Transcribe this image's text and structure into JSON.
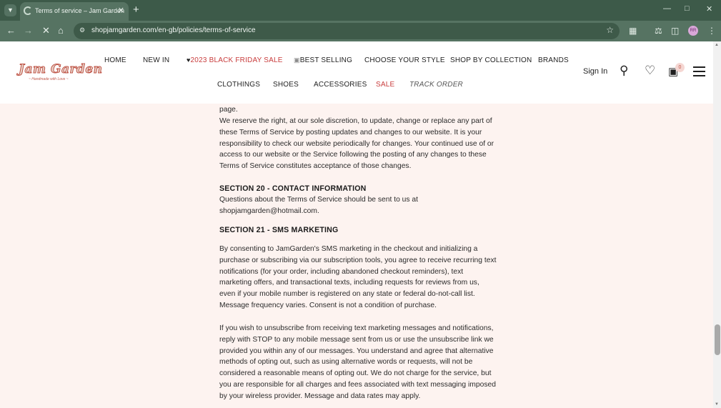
{
  "browser": {
    "tab_title": "Terms of service – Jam Garden",
    "url": "shopjamgarden.com/en-gb/policies/terms-of-service",
    "profile_initials": "RR"
  },
  "icons": {
    "tab_search": "chevron-down-icon",
    "spinner": "loading-spinner-icon",
    "tab_close": "close-icon",
    "new_tab": "plus-icon",
    "back": "arrow-left-icon",
    "forward": "arrow-right-icon",
    "stop": "close-icon",
    "home": "home-icon",
    "site_info": "tune-icon",
    "bookmark": "star-icon",
    "extensions": "puzzle-icon",
    "labs": "flask-icon",
    "sidebar": "sidebar-icon",
    "menu": "more-vertical-icon",
    "search": "search-icon",
    "wishlist": "heart-icon",
    "cart": "cart-icon",
    "hamburger": "hamburger-icon"
  },
  "site": {
    "logo_text": "Jam Garden",
    "logo_tagline": "~ Handmade with Love ~",
    "nav_row1": [
      "HOME",
      "NEW IN",
      "2023 BLACK FRIDAY SALE",
      "BEST SELLING",
      "CHOOSE YOUR STYLE",
      "SHOP BY COLLECTION",
      "BRANDS"
    ],
    "nav_row2": [
      "CLOTHINGS",
      "SHOES",
      "ACCESSORIES",
      "SALE",
      "TRACK ORDER"
    ],
    "sign_in": "Sign In",
    "cart_count": "0"
  },
  "colors": {
    "accent_red": "#c83c3c",
    "page_bg": "#fdf3f0",
    "browser_frame": "#3d5a49"
  },
  "article": {
    "p_page": "page.",
    "p_reserve": "We reserve the right, at our sole discretion, to update, change or replace any part of these Terms of Service by posting updates and changes to our website. It is your responsibility to check our website periodically for changes. Your continued use of or access to our website or the Service following the posting of any changes to these Terms of Service constitutes acceptance of those changes.",
    "s20_title": "SECTION 20 - CONTACT INFORMATION",
    "s20_text": "Questions about the Terms of Service should be sent to us at shopjamgarden@hotmail.com.",
    "s21_title": "SECTION 21 - SMS MARKETING",
    "s21_p1": "By consenting to JamGarden's SMS marketing in the checkout and initializing a purchase or subscribing via our subscription tools, you agree to receive recurring text notifications (for your order, including abandoned checkout reminders), text marketing offers, and transactional texts, including requests for reviews from us, even if your mobile number is registered on any state or federal do-not-call list. Message frequency varies. Consent is not a condition of purchase.",
    "s21_p2": "If you wish to unsubscribe from receiving text marketing messages and notifications, reply with STOP to any mobile message sent from us or use the unsubscribe link we provided you within any of our messages. You understand and agree that alternative methods of opting out, such as using alternative words or requests, will not be considered a reasonable means of opting out. We do not charge for the service, but you are responsible for all charges and fees associated with text messaging imposed by your wireless provider. Message and data rates may apply."
  }
}
